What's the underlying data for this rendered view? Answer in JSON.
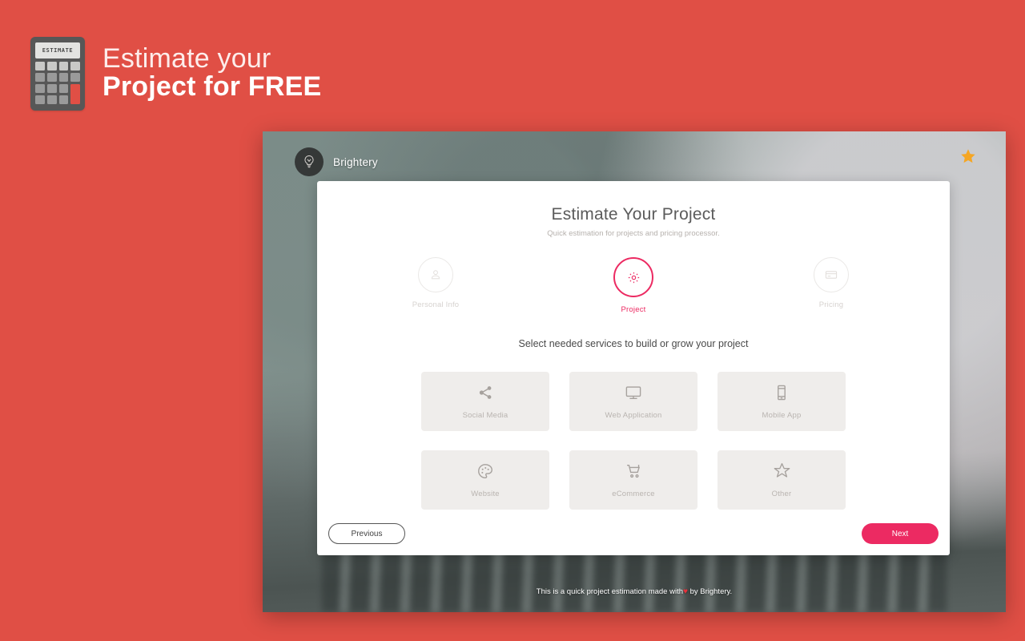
{
  "promo": {
    "calculator_display": "ESTIMATE",
    "line1": "Estimate your",
    "line2": "Project for FREE"
  },
  "colors": {
    "page_background": "#E04F45",
    "accent_pink": "#EC2A62",
    "card_background": "#FFFFFF",
    "service_tile": "#EFEDEB",
    "star": "#F5A623",
    "heart": "#E8313B"
  },
  "window": {
    "brand": {
      "name": "Brightery",
      "logo_icon": "lightbulb-icon"
    },
    "star_icon": "star-icon",
    "footer_text_before": "This is a quick project estimation made with",
    "footer_heart": "♥",
    "footer_text_after": "by Brightery."
  },
  "card": {
    "title": "Estimate Your Project",
    "subtitle": "Quick estimation for projects and pricing processor.",
    "steps": [
      {
        "label": "Personal Info",
        "icon": "user-icon",
        "active": false
      },
      {
        "label": "Project",
        "icon": "gear-icon",
        "active": true
      },
      {
        "label": "Pricing",
        "icon": "credit-card-icon",
        "active": false
      }
    ],
    "prompt": "Select needed services to build or grow your project",
    "services": [
      {
        "label": "Social Media",
        "icon": "share-icon"
      },
      {
        "label": "Web Application",
        "icon": "monitor-icon"
      },
      {
        "label": "Mobile App",
        "icon": "smartphone-icon"
      },
      {
        "label": "Website",
        "icon": "palette-icon"
      },
      {
        "label": "eCommerce",
        "icon": "shopping-cart-icon"
      },
      {
        "label": "Other",
        "icon": "star-outline-icon"
      }
    ],
    "previous_label": "Previous",
    "next_label": "Next"
  }
}
